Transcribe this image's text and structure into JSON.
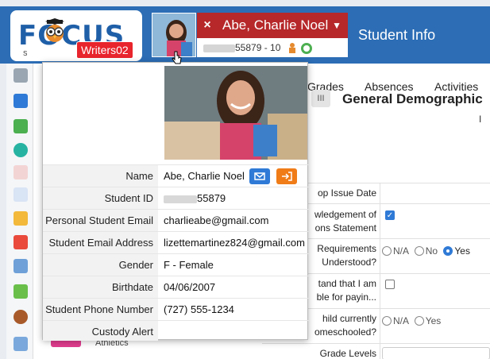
{
  "header": {
    "logo_text": "FOCUS",
    "logo_sub": "S",
    "instance_badge": "Writers02",
    "close_label": "×",
    "student_name": "Abe, Charlie Noel",
    "student_id_suffix": "55879",
    "student_grade_sep": " - 10",
    "page_title": "Student Info"
  },
  "tabs": [
    {
      "label": "Grades"
    },
    {
      "label": "Absences"
    },
    {
      "label": "Activities"
    }
  ],
  "section": {
    "title": "General Demographic",
    "grid_label": "III",
    "marker": "I"
  },
  "form_rows": [
    {
      "label": "op Issue Date"
    },
    {
      "label": "wledgement of\nons Statement"
    },
    {
      "label": "Requirements\nUnderstood?"
    },
    {
      "label": "tand that I am\nble for payin..."
    },
    {
      "label": "hild currently\nomeschooled?"
    },
    {
      "label": "Grade Levels"
    }
  ],
  "radio_options": {
    "row3": [
      {
        "label": "N/A"
      },
      {
        "label": "No"
      },
      {
        "label": "Yes"
      }
    ],
    "row5": [
      {
        "label": "N/A"
      },
      {
        "label": "Yes"
      }
    ]
  },
  "athletics_label": "Athletics",
  "popup": {
    "fields": [
      {
        "label": "Name",
        "value": "Abe, Charlie Noel"
      },
      {
        "label": "Student ID",
        "value": "55879"
      },
      {
        "label": "Personal Student Email",
        "value": "charlieabe@gmail.com"
      },
      {
        "label": "Student Email Address",
        "value": "lizettemartinez824@gmail.com"
      },
      {
        "label": "Gender",
        "value": "F - Female"
      },
      {
        "label": "Birthdate",
        "value": "04/06/2007"
      },
      {
        "label": "Student Phone Number",
        "value": "(727) 555-1234"
      },
      {
        "label": "Custody Alert",
        "value": ""
      }
    ]
  },
  "colors": {
    "header_blue": "#2c6db5",
    "close_red": "#b6282a",
    "badge_red": "#e8242c",
    "mail_blue": "#2f7ad6",
    "login_orange": "#f07c18"
  }
}
